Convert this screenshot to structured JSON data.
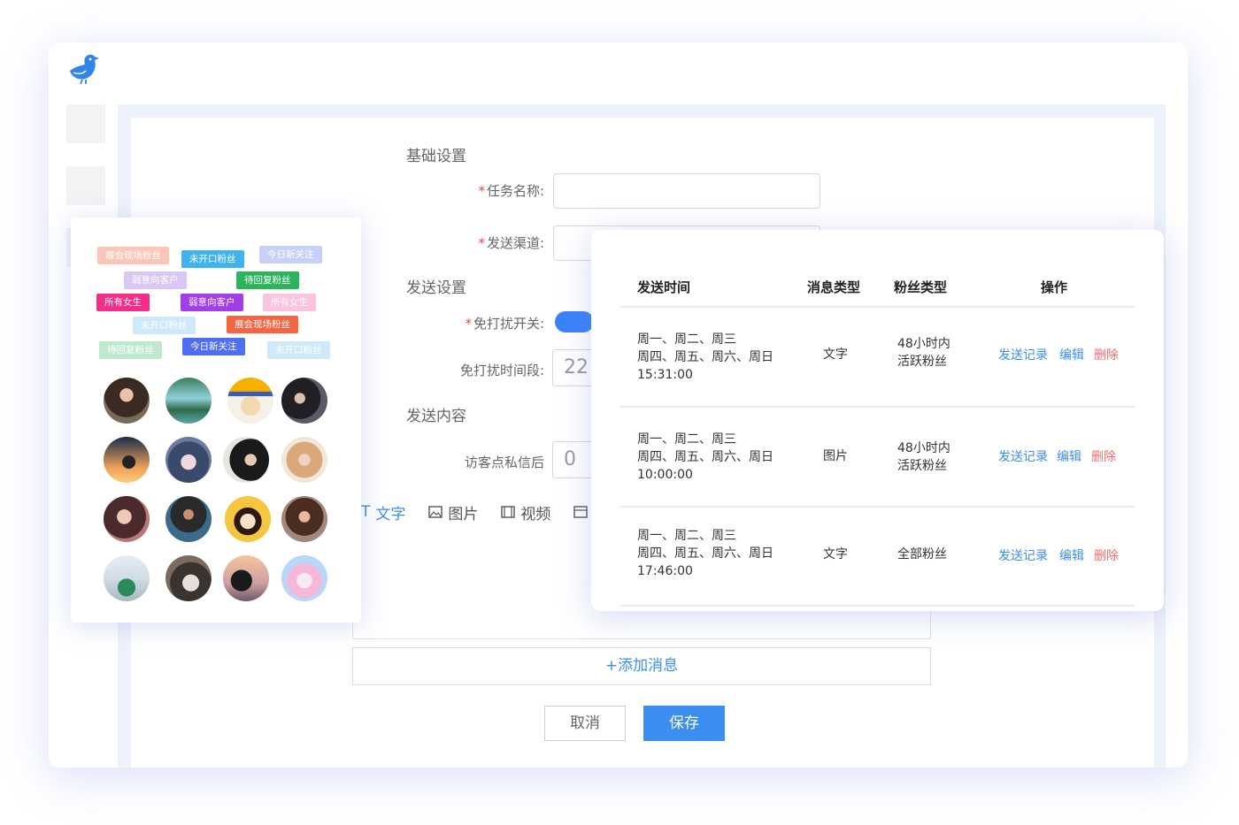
{
  "colors": {
    "accent": "#3b8ef0",
    "danger": "#f06c6c",
    "required": "#e94545"
  },
  "form": {
    "section_basic": "基础设置",
    "task_name_label": "任务名称:",
    "channel_label": "发送渠道:",
    "required_mark": "*",
    "section_send": "发送设置",
    "dnd_switch_label": "免打扰开关:",
    "dnd_period_label": "免打扰时间段:",
    "dnd_period_value": "22",
    "section_content": "发送内容",
    "visitor_label": "访客点私信后",
    "visitor_value": "0",
    "toolbar": [
      {
        "label": "文字",
        "icon": "text-icon"
      },
      {
        "label": "图片",
        "icon": "image-icon"
      },
      {
        "label": "视频",
        "icon": "video-icon"
      }
    ],
    "add_message": "+添加消息",
    "cancel": "取消",
    "save": "保存"
  },
  "tags": [
    {
      "label": "展会现场粉丝",
      "color": "#fbc6b7"
    },
    {
      "label": "未开口粉丝",
      "color": "#3fb3f0"
    },
    {
      "label": "今日新关注",
      "color": "#c9d0f7"
    },
    {
      "label": "弱意向客户",
      "color": "#dcc7f4"
    },
    {
      "label": "待回复粉丝",
      "color": "#2cb35c"
    },
    {
      "label": "所有女生",
      "color": "#f32d8a"
    },
    {
      "label": "弱意向客户",
      "color": "#a23ee8"
    },
    {
      "label": "所有女生",
      "color": "#fbc4de"
    },
    {
      "label": "未开口粉丝",
      "color": "#cfe9fb"
    },
    {
      "label": "展会现场粉丝",
      "color": "#f56542"
    },
    {
      "label": "待回复粉丝",
      "color": "#bfe9cd"
    },
    {
      "label": "今日新关注",
      "color": "#4f6ef0"
    },
    {
      "label": "未开口粉丝",
      "color": "#cfe9fb"
    }
  ],
  "table": {
    "headers": [
      "发送时间",
      "消息类型",
      "粉丝类型",
      "操作"
    ],
    "rows": [
      {
        "time_line1": "周一、周二、周三",
        "time_line2": "周四、周五、周六、周日",
        "time_line3": "15:31:00",
        "msg_type": "文字",
        "fan_line1": "48小时内",
        "fan_line2": "活跃粉丝",
        "record": "发送记录",
        "edit": "编辑",
        "delete": "删除"
      },
      {
        "time_line1": "周一、周二、周三",
        "time_line2": "周四、周五、周六、周日",
        "time_line3": "10:00:00",
        "msg_type": "图片",
        "fan_line1": "48小时内",
        "fan_line2": "活跃粉丝",
        "record": "发送记录",
        "edit": "编辑",
        "delete": "删除"
      },
      {
        "time_line1": "周一、周二、周三",
        "time_line2": "周四、周五、周六、周日",
        "time_line3": "17:46:00",
        "msg_type": "文字",
        "fan_line1": "全部粉丝",
        "fan_line2": "",
        "record": "发送记录",
        "edit": "编辑",
        "delete": "删除"
      }
    ]
  }
}
